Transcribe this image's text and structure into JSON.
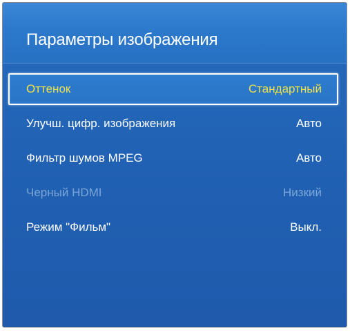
{
  "panel": {
    "title": "Параметры изображения"
  },
  "menu": {
    "items": [
      {
        "label": "Оттенок",
        "value": "Стандартный",
        "state": "selected"
      },
      {
        "label": "Улучш. цифр. изображения",
        "value": "Авто",
        "state": "normal"
      },
      {
        "label": "Фильтр шумов MPEG",
        "value": "Авто",
        "state": "normal"
      },
      {
        "label": "Черный HDMI",
        "value": "Низкий",
        "state": "disabled"
      },
      {
        "label": "Режим \"Фильм\"",
        "value": "Выкл.",
        "state": "normal"
      }
    ]
  },
  "colors": {
    "background": "#205fb2",
    "highlight_text": "#f0e245",
    "disabled_text": "#7aa6d6",
    "text": "#ffffff"
  }
}
